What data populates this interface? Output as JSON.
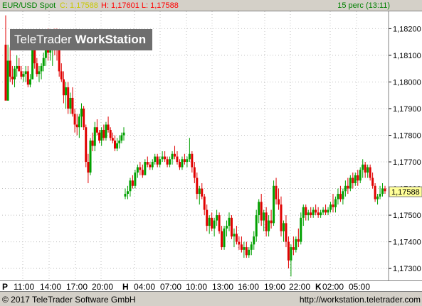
{
  "title_bar": {
    "instrument": "EUR/USD Spot",
    "close": "C: 1,17588",
    "high_low": "H: 1,17601 L: 1,17588",
    "timeframe": "15 perc (13:11)"
  },
  "watermark": {
    "light": "TeleTrader ",
    "bold": "WorkStation"
  },
  "footer": {
    "copyright": "© 2017  TeleTrader Software GmbH",
    "url": "http://workstation.teletrader.com"
  },
  "x_axis": {
    "labels": [
      {
        "text": "P",
        "day": true
      },
      {
        "text": "11:00"
      },
      {
        "text": "14:00"
      },
      {
        "text": "17:00"
      },
      {
        "text": "20:00"
      },
      {
        "text": "H",
        "day": true
      },
      {
        "text": "04:00"
      },
      {
        "text": "07:00"
      },
      {
        "text": "10:00"
      },
      {
        "text": "13:00"
      },
      {
        "text": "16:00"
      },
      {
        "text": "19:00"
      },
      {
        "text": "22:00"
      },
      {
        "text": "K",
        "day": true
      },
      {
        "text": "02:00"
      },
      {
        "text": "05:00"
      }
    ]
  },
  "colors": {
    "up": "#00a000",
    "down": "#e00000",
    "grid": "#c0c0c0",
    "last_price_bg": "#ffff99"
  },
  "chart_data": {
    "type": "candlestick",
    "title": "EUR/USD Spot",
    "timeframe": "15 perc",
    "ylim": [
      1.17255,
      1.18265
    ],
    "y_ticks": [
      "1,17300",
      "1,17400",
      "1,17500",
      "1,17600",
      "1,17700",
      "1,17800",
      "1,17900",
      "1,18000",
      "1,18100",
      "1,18200"
    ],
    "last_price": "1,17588",
    "grid": true,
    "candles": [
      [
        1.1814,
        1.1825,
        1.1801,
        1.1793
      ],
      [
        1.1793,
        1.1814,
        1.1793,
        1.1808
      ],
      [
        1.1808,
        1.1813,
        1.18,
        1.1802
      ],
      [
        1.1802,
        1.1806,
        1.1799,
        1.1801
      ],
      [
        1.1801,
        1.1806,
        1.1798,
        1.1805
      ],
      [
        1.1805,
        1.181,
        1.1802,
        1.1806
      ],
      [
        1.1806,
        1.1809,
        1.1804,
        1.1804
      ],
      [
        1.1804,
        1.1806,
        1.1801,
        1.1802
      ],
      [
        1.1802,
        1.1804,
        1.18,
        1.1803
      ],
      [
        1.1803,
        1.1806,
        1.18,
        1.1804
      ],
      [
        1.1804,
        1.1806,
        1.1798,
        1.1799
      ],
      [
        1.1799,
        1.1803,
        1.1798,
        1.1801
      ],
      [
        1.1801,
        1.1815,
        1.1801,
        1.1812
      ],
      [
        1.1812,
        1.1815,
        1.1805,
        1.1807
      ],
      [
        1.1807,
        1.1809,
        1.1802,
        1.1803
      ],
      [
        1.1803,
        1.1806,
        1.18,
        1.1804
      ],
      [
        1.1804,
        1.1807,
        1.1801,
        1.1806
      ],
      [
        1.1806,
        1.1811,
        1.1804,
        1.1809
      ],
      [
        1.1809,
        1.1816,
        1.1806,
        1.1815
      ],
      [
        1.1815,
        1.182,
        1.1808,
        1.1811
      ],
      [
        1.1811,
        1.1817,
        1.1808,
        1.1813
      ],
      [
        1.1813,
        1.1818,
        1.1806,
        1.1818
      ],
      [
        1.1818,
        1.182,
        1.181,
        1.1817
      ],
      [
        1.1817,
        1.182,
        1.1808,
        1.1813
      ],
      [
        1.1813,
        1.1814,
        1.1802,
        1.1804
      ],
      [
        1.1804,
        1.1807,
        1.18,
        1.1801
      ],
      [
        1.1801,
        1.1804,
        1.1792,
        1.1795
      ],
      [
        1.1795,
        1.18,
        1.179,
        1.1798
      ],
      [
        1.1798,
        1.18,
        1.1788,
        1.179
      ],
      [
        1.179,
        1.1796,
        1.1788,
        1.1794
      ],
      [
        1.1794,
        1.1798,
        1.1787,
        1.1788
      ],
      [
        1.1788,
        1.179,
        1.1781,
        1.1784
      ],
      [
        1.1784,
        1.1788,
        1.178,
        1.1783
      ],
      [
        1.1783,
        1.1788,
        1.1779,
        1.1787
      ],
      [
        1.1787,
        1.1792,
        1.1783,
        1.179
      ],
      [
        1.179,
        1.1791,
        1.1782,
        1.1783
      ],
      [
        1.1783,
        1.1784,
        1.1768,
        1.177
      ],
      [
        1.177,
        1.1773,
        1.1762,
        1.1766
      ],
      [
        1.1766,
        1.1779,
        1.1765,
        1.1778
      ],
      [
        1.1778,
        1.1781,
        1.1774,
        1.1776
      ],
      [
        1.1776,
        1.1785,
        1.1774,
        1.1783
      ],
      [
        1.1783,
        1.1786,
        1.178,
        1.1781
      ],
      [
        1.1781,
        1.1782,
        1.1777,
        1.1778
      ],
      [
        1.1778,
        1.1783,
        1.1776,
        1.1782
      ],
      [
        1.1782,
        1.1784,
        1.1778,
        1.1779
      ],
      [
        1.1779,
        1.1785,
        1.1778,
        1.1784
      ],
      [
        1.1784,
        1.1787,
        1.1781,
        1.1782
      ],
      [
        1.1782,
        1.1783,
        1.1778,
        1.1779
      ],
      [
        1.1779,
        1.1781,
        1.1777,
        1.1778
      ],
      [
        1.1778,
        1.178,
        1.1774,
        1.1775
      ],
      [
        1.1775,
        1.1779,
        1.1774,
        1.1777
      ],
      [
        1.1777,
        1.178,
        1.1775,
        1.1778
      ],
      [
        1.1778,
        1.1781,
        1.1777,
        1.178
      ],
      [
        1.178,
        1.1783,
        1.1778,
        1.1781
      ],
      [
        1.1757,
        1.176,
        1.1756,
        1.1758
      ],
      [
        1.1758,
        1.1761,
        1.1756,
        1.1759
      ],
      [
        1.1759,
        1.1764,
        1.1757,
        1.1763
      ],
      [
        1.1763,
        1.1765,
        1.176,
        1.1761
      ],
      [
        1.1761,
        1.1767,
        1.176,
        1.1766
      ],
      [
        1.1766,
        1.1769,
        1.1764,
        1.1768
      ],
      [
        1.1768,
        1.177,
        1.1765,
        1.1767
      ],
      [
        1.1767,
        1.1769,
        1.1764,
        1.1765
      ],
      [
        1.1765,
        1.1771,
        1.1765,
        1.177
      ],
      [
        1.177,
        1.1772,
        1.1768,
        1.1769
      ],
      [
        1.1769,
        1.177,
        1.1767,
        1.1768
      ],
      [
        1.1768,
        1.1771,
        1.1767,
        1.177
      ],
      [
        1.177,
        1.1773,
        1.1769,
        1.1772
      ],
      [
        1.1772,
        1.1773,
        1.1768,
        1.1769
      ],
      [
        1.1769,
        1.1772,
        1.1768,
        1.1771
      ],
      [
        1.1771,
        1.1774,
        1.177,
        1.1772
      ],
      [
        1.1772,
        1.1774,
        1.177,
        1.1771
      ],
      [
        1.1771,
        1.1772,
        1.1768,
        1.1769
      ],
      [
        1.1769,
        1.1772,
        1.1768,
        1.1771
      ],
      [
        1.1771,
        1.1774,
        1.1769,
        1.1773
      ],
      [
        1.1773,
        1.1776,
        1.1771,
        1.1772
      ],
      [
        1.1772,
        1.1774,
        1.1769,
        1.177
      ],
      [
        1.177,
        1.1771,
        1.1767,
        1.1768
      ],
      [
        1.1768,
        1.1772,
        1.1767,
        1.1771
      ],
      [
        1.1771,
        1.1773,
        1.1769,
        1.177
      ],
      [
        1.177,
        1.1772,
        1.1768,
        1.1771
      ],
      [
        1.1771,
        1.1779,
        1.177,
        1.1773
      ],
      [
        1.1773,
        1.1774,
        1.1766,
        1.1768
      ],
      [
        1.1768,
        1.177,
        1.1762,
        1.1764
      ],
      [
        1.1764,
        1.1766,
        1.1756,
        1.1758
      ],
      [
        1.1758,
        1.1761,
        1.1754,
        1.176
      ],
      [
        1.176,
        1.1762,
        1.1756,
        1.1757
      ],
      [
        1.1757,
        1.1758,
        1.175,
        1.1752
      ],
      [
        1.1752,
        1.1754,
        1.1744,
        1.1746
      ],
      [
        1.1746,
        1.175,
        1.1743,
        1.1749
      ],
      [
        1.1749,
        1.1751,
        1.1744,
        1.1745
      ],
      [
        1.1745,
        1.1749,
        1.1742,
        1.1748
      ],
      [
        1.1748,
        1.1752,
        1.1746,
        1.175
      ],
      [
        1.175,
        1.1751,
        1.1743,
        1.1744
      ],
      [
        1.1744,
        1.1746,
        1.1737,
        1.1738
      ],
      [
        1.1738,
        1.1746,
        1.1737,
        1.1745
      ],
      [
        1.1745,
        1.1748,
        1.1742,
        1.1746
      ],
      [
        1.1746,
        1.1751,
        1.1744,
        1.1749
      ],
      [
        1.1749,
        1.175,
        1.1741,
        1.1742
      ],
      [
        1.1742,
        1.1745,
        1.1738,
        1.1743
      ],
      [
        1.1743,
        1.1746,
        1.1739,
        1.174
      ],
      [
        1.174,
        1.1742,
        1.1737,
        1.1739
      ],
      [
        1.1739,
        1.1742,
        1.1736,
        1.1737
      ],
      [
        1.1737,
        1.174,
        1.1734,
        1.1738
      ],
      [
        1.1738,
        1.174,
        1.1734,
        1.1735
      ],
      [
        1.1735,
        1.1738,
        1.1734,
        1.1737
      ],
      [
        1.1737,
        1.174,
        1.1735,
        1.1739
      ],
      [
        1.1739,
        1.1744,
        1.1737,
        1.1742
      ],
      [
        1.1742,
        1.1752,
        1.174,
        1.175
      ],
      [
        1.175,
        1.1756,
        1.1747,
        1.1755
      ],
      [
        1.1755,
        1.1758,
        1.1746,
        1.1748
      ],
      [
        1.1748,
        1.1752,
        1.1744,
        1.1751
      ],
      [
        1.1751,
        1.1753,
        1.1742,
        1.1744
      ],
      [
        1.1744,
        1.175,
        1.1742,
        1.1748
      ],
      [
        1.1748,
        1.1752,
        1.1745,
        1.1747
      ],
      [
        1.1747,
        1.1763,
        1.1746,
        1.1761
      ],
      [
        1.1761,
        1.1764,
        1.1754,
        1.1756
      ],
      [
        1.1756,
        1.176,
        1.1752,
        1.1754
      ],
      [
        1.1754,
        1.1757,
        1.1742,
        1.1744
      ],
      [
        1.1744,
        1.1748,
        1.174,
        1.1747
      ],
      [
        1.1747,
        1.175,
        1.1738,
        1.174
      ],
      [
        1.174,
        1.1742,
        1.173,
        1.1733
      ],
      [
        1.1733,
        1.1739,
        1.1727,
        1.1738
      ],
      [
        1.1738,
        1.1742,
        1.1735,
        1.1737
      ],
      [
        1.1737,
        1.1742,
        1.1736,
        1.1741
      ],
      [
        1.1741,
        1.1745,
        1.1738,
        1.174
      ],
      [
        1.174,
        1.1751,
        1.1739,
        1.1749
      ],
      [
        1.1749,
        1.1754,
        1.1746,
        1.1753
      ],
      [
        1.1753,
        1.1754,
        1.1748,
        1.175
      ],
      [
        1.175,
        1.1752,
        1.1748,
        1.1751
      ],
      [
        1.1751,
        1.1753,
        1.1749,
        1.175
      ],
      [
        1.175,
        1.1753,
        1.1749,
        1.1752
      ],
      [
        1.1752,
        1.1754,
        1.175,
        1.1751
      ],
      [
        1.1751,
        1.1753,
        1.1749,
        1.175
      ],
      [
        1.175,
        1.1752,
        1.1749,
        1.1751
      ],
      [
        1.1751,
        1.1753,
        1.175,
        1.1752
      ],
      [
        1.1752,
        1.1754,
        1.175,
        1.1751
      ],
      [
        1.1751,
        1.1753,
        1.175,
        1.1752
      ],
      [
        1.1752,
        1.1755,
        1.1751,
        1.1754
      ],
      [
        1.1754,
        1.1758,
        1.1751,
        1.1753
      ],
      [
        1.1753,
        1.1757,
        1.1751,
        1.1756
      ],
      [
        1.1756,
        1.176,
        1.1754,
        1.1758
      ],
      [
        1.1758,
        1.1761,
        1.1755,
        1.1756
      ],
      [
        1.1756,
        1.176,
        1.1754,
        1.1759
      ],
      [
        1.1759,
        1.1763,
        1.1757,
        1.1761
      ],
      [
        1.1761,
        1.1764,
        1.1758,
        1.176
      ],
      [
        1.176,
        1.1765,
        1.1759,
        1.1764
      ],
      [
        1.1764,
        1.1766,
        1.176,
        1.1762
      ],
      [
        1.1762,
        1.1766,
        1.1761,
        1.1765
      ],
      [
        1.1765,
        1.1767,
        1.1761,
        1.1763
      ],
      [
        1.1763,
        1.1768,
        1.1762,
        1.1767
      ],
      [
        1.1767,
        1.1771,
        1.1764,
        1.1769
      ],
      [
        1.1769,
        1.177,
        1.1764,
        1.1766
      ],
      [
        1.1766,
        1.1769,
        1.1764,
        1.1768
      ],
      [
        1.1768,
        1.1769,
        1.1763,
        1.1764
      ],
      [
        1.1764,
        1.1766,
        1.176,
        1.1761
      ],
      [
        1.1761,
        1.1762,
        1.1755,
        1.1756
      ],
      [
        1.1756,
        1.1758,
        1.1754,
        1.1757
      ],
      [
        1.1757,
        1.1761,
        1.1756,
        1.1758
      ],
      [
        1.1758,
        1.1762,
        1.1757,
        1.176
      ],
      [
        1.176,
        1.1761,
        1.1758,
        1.1759
      ]
    ]
  }
}
